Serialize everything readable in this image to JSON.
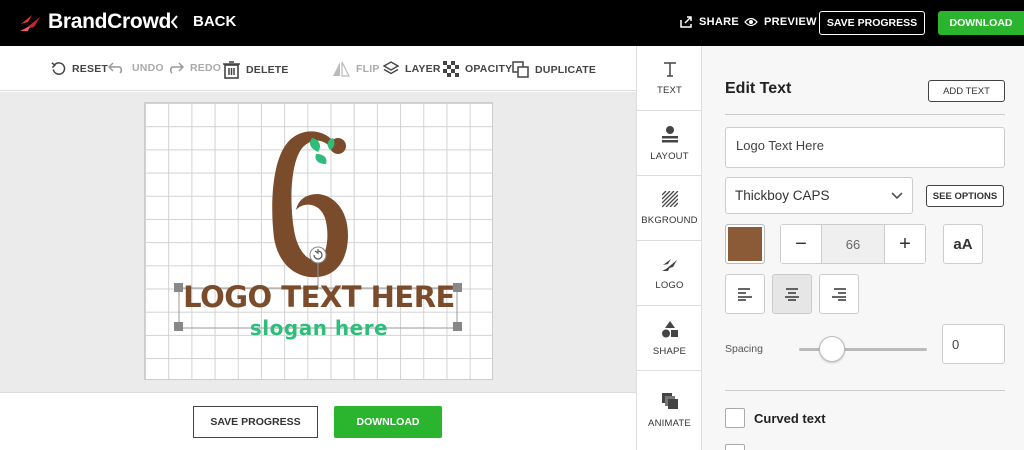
{
  "header": {
    "brand": "BrandCrowd",
    "back_label": "BACK",
    "share_label": "SHARE",
    "preview_label": "PREVIEW",
    "save_progress_label": "SAVE PROGRESS",
    "download_label": "DOWNLOAD"
  },
  "toolbar": {
    "reset": "RESET",
    "undo": "UNDO",
    "redo": "REDO",
    "delete": "DELETE",
    "flip": "FLIP",
    "layer": "LAYER",
    "opacity": "OPACITY",
    "duplicate": "DUPLICATE"
  },
  "canvas": {
    "logo_text": "LOGO TEXT HERE",
    "slogan": "slogan here",
    "text_color": "#7b4c2c",
    "slogan_color": "#2ebd7a"
  },
  "bottom": {
    "save_progress_label": "SAVE PROGRESS",
    "download_label": "DOWNLOAD"
  },
  "side_tabs": [
    {
      "label": "TEXT",
      "icon": "text-icon"
    },
    {
      "label": "LAYOUT",
      "icon": "layout-icon"
    },
    {
      "label": "BKGROUND",
      "icon": "background-icon"
    },
    {
      "label": "LOGO",
      "icon": "logo-icon"
    },
    {
      "label": "SHAPE",
      "icon": "shape-icon"
    },
    {
      "label": "ANIMATE",
      "icon": "animate-icon"
    }
  ],
  "panel": {
    "title": "Edit Text",
    "add_text_label": "ADD TEXT",
    "text_value": "Logo Text Here",
    "font_name": "Thickboy CAPS",
    "see_options_label": "SEE OPTIONS",
    "color": "#8b5a36",
    "font_size": "66",
    "case_label": "aA",
    "alignment": "center",
    "spacing_label": "Spacing",
    "spacing_value": "0",
    "spacing_slider_fraction": 0.2,
    "curved_text_label": "Curved text"
  },
  "colors": {
    "accent_green": "#2bb52f",
    "brand_red": "#e8323c",
    "logo_brown": "#7b4c2c",
    "leaf_green": "#2ebd7a"
  }
}
